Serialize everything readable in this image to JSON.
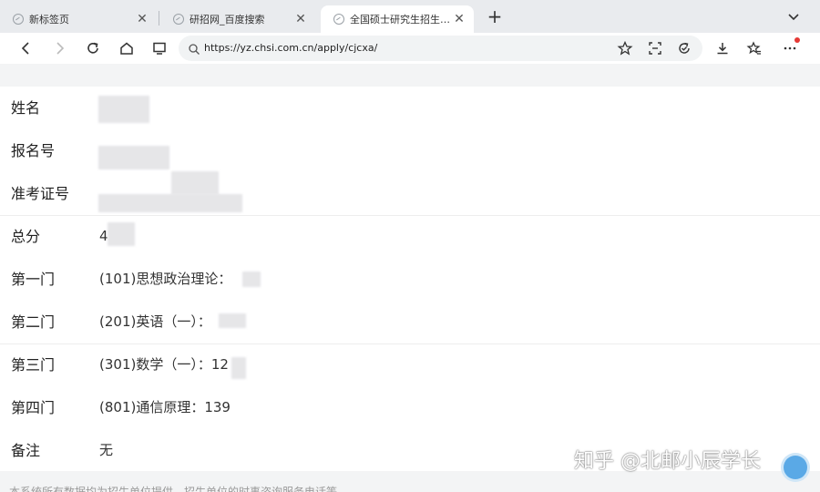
{
  "tabs": [
    {
      "title": "新标签页"
    },
    {
      "title": "研招网_百度搜索"
    },
    {
      "title": "全国硕士研究生招生…"
    }
  ],
  "address": {
    "url": "https://yz.chsi.com.cn/apply/cjcxa/"
  },
  "rows": [
    {
      "label": "姓名",
      "value": ""
    },
    {
      "label": "报名号",
      "value": ""
    },
    {
      "label": "准考证号",
      "value": ""
    },
    {
      "label": "总分",
      "value": "4"
    },
    {
      "label": "第一门",
      "value": "(101)思想政治理论："
    },
    {
      "label": "第二门",
      "value": "(201)英语（一）："
    },
    {
      "label": "第三门",
      "value": "(301)数学（一）：12"
    },
    {
      "label": "第四门",
      "value": "(801)通信原理：139"
    },
    {
      "label": "备注",
      "value": "无"
    }
  ],
  "footer": {
    "text": "本系统所有数据均为招生单位提供，招生单位的时事咨询服务电话等"
  },
  "watermark": {
    "text": "知乎 @北邮小辰学长"
  },
  "colors": {
    "accent": "#5aa9e6",
    "notify": "#e53935"
  }
}
